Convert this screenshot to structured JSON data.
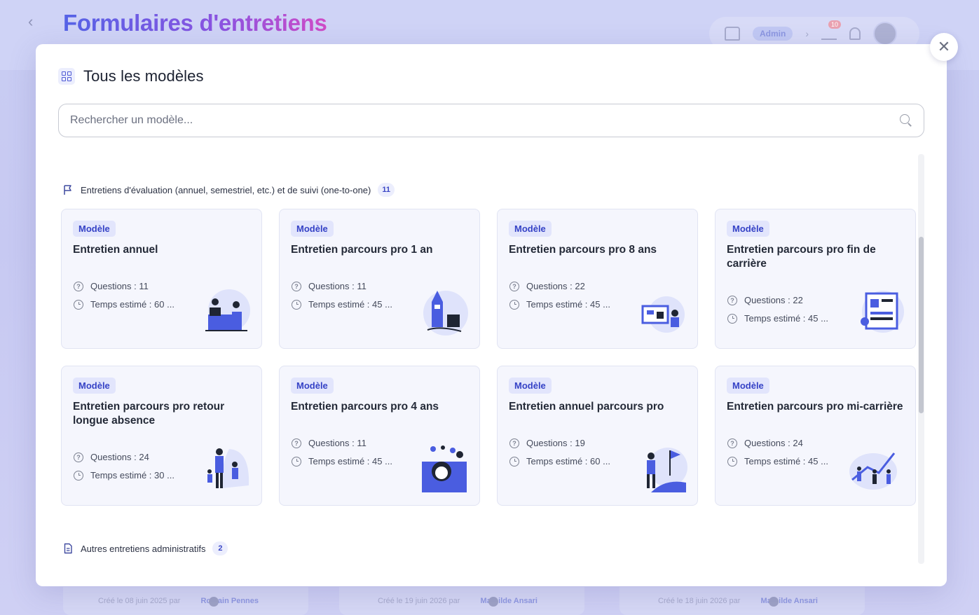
{
  "background": {
    "title": "Formulaires d'entretiens",
    "admin_label": "Admin",
    "cart_badge": "10",
    "footer_cards": [
      {
        "text": "Créé le 08 juin 2025 par",
        "author": "Romain Pennes"
      },
      {
        "text": "Créé le 19 juin 2026 par",
        "author": "Mathilde Ansari"
      },
      {
        "text": "Créé le 18 juin 2026 par",
        "author": "Mathilde Ansari"
      }
    ]
  },
  "modal": {
    "title": "Tous les modèles",
    "search_placeholder": "Rechercher un modèle...",
    "icons": {
      "header": "grid-icon",
      "close": "close-icon",
      "search": "search-icon"
    }
  },
  "sections": [
    {
      "label": "Entretiens d'évaluation (annuel, semestriel, etc.) et de suivi (one-to-one)",
      "count": "11",
      "icon": "flag-icon",
      "cards": [
        {
          "tag": "Modèle",
          "title": "Entretien annuel",
          "questions": "Questions : 11",
          "time": "Temps estimé : 60 ...",
          "illustration": "office-meeting"
        },
        {
          "tag": "Modèle",
          "title": "Entretien parcours pro 1 an",
          "questions": "Questions : 11",
          "time": "Temps estimé : 45 ...",
          "illustration": "rocket-launch"
        },
        {
          "tag": "Modèle",
          "title": "Entretien parcours pro 8 ans",
          "questions": "Questions : 22",
          "time": "Temps estimé : 45 ...",
          "illustration": "dashboard-work"
        },
        {
          "tag": "Modèle",
          "title": "Entretien parcours pro fin de carrière",
          "questions": "Questions : 22",
          "time": "Temps estimé : 45 ...",
          "illustration": "report-screen"
        },
        {
          "tag": "Modèle",
          "title": "Entretien parcours pro retour longue absence",
          "questions": "Questions : 24",
          "time": "Temps estimé : 30 ...",
          "illustration": "family-walk"
        },
        {
          "tag": "Modèle",
          "title": "Entretien parcours pro 4 ans",
          "questions": "Questions : 11",
          "time": "Temps estimé : 45 ...",
          "illustration": "ideas-person"
        },
        {
          "tag": "Modèle",
          "title": "Entretien annuel parcours pro",
          "questions": "Questions : 19",
          "time": "Temps estimé : 60 ...",
          "illustration": "goal-flag"
        },
        {
          "tag": "Modèle",
          "title": "Entretien parcours pro mi-carrière",
          "questions": "Questions : 24",
          "time": "Temps estimé : 45 ...",
          "illustration": "team-growth"
        }
      ]
    },
    {
      "label": "Autres entretiens administratifs",
      "count": "2",
      "icon": "document-icon",
      "cards": []
    }
  ],
  "colors": {
    "accent": "#3d49c6",
    "tag_bg": "#e2e5fc",
    "card_bg": "#f5f6fd",
    "illustration": "#4a5de0"
  }
}
